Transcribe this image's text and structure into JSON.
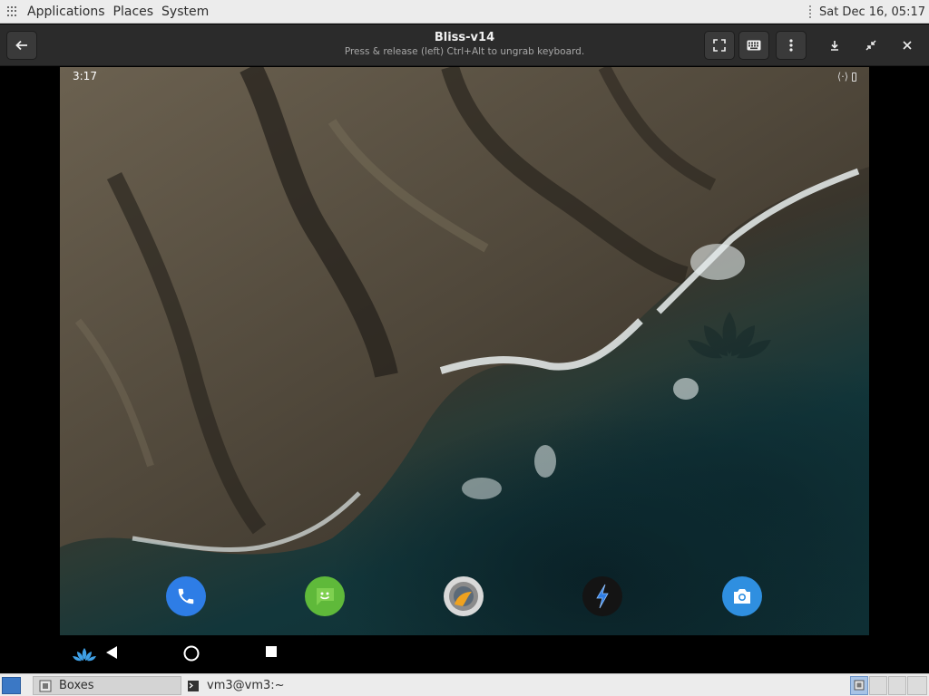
{
  "top_panel": {
    "menus": [
      "Applications",
      "Places",
      "System"
    ],
    "clock": "Sat Dec 16, 05:17"
  },
  "header": {
    "title": "Bliss-v14",
    "subtitle": "Press & release (left) Ctrl+Alt to ungrab keyboard.",
    "icons": [
      "back-arrow-icon",
      "fullscreen-icon",
      "keyboard-icon",
      "more-vertical-icon",
      "download-icon",
      "restore-icon",
      "close-icon"
    ]
  },
  "vm": {
    "status_time": "3:17",
    "dock_apps": [
      "phone",
      "messaging",
      "browser",
      "launcher",
      "camera"
    ],
    "nav_buttons": [
      "lotus-menu",
      "back",
      "home",
      "recents"
    ]
  },
  "taskbar": {
    "tasks": [
      {
        "label": "Boxes",
        "active": true
      },
      {
        "label": "vm3@vm3:~",
        "active": false
      }
    ]
  },
  "colors": {
    "panel_bg": "#ececec",
    "header_bg": "#2b2b2b",
    "phone": "#2e7de6",
    "messaging": "#5fb93a",
    "camera": "#2f8fe0"
  }
}
